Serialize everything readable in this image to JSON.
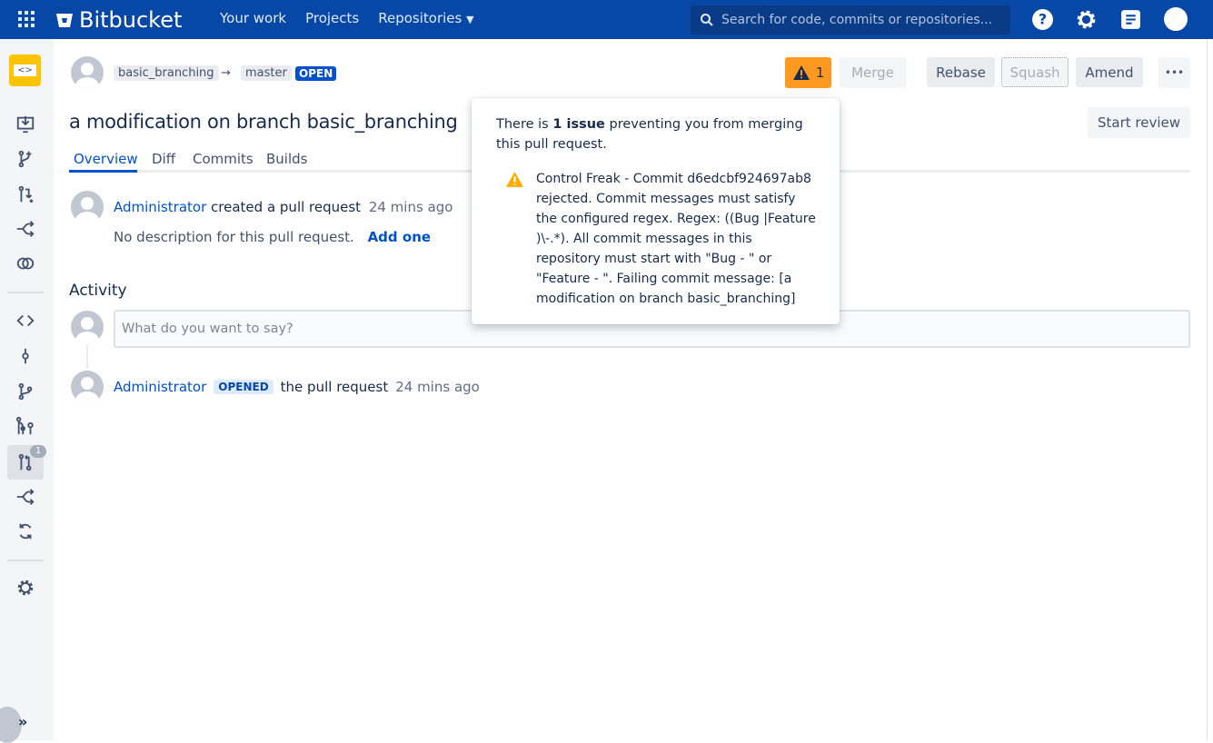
{
  "header": {
    "brand": "Bitbucket",
    "nav": [
      "Your work",
      "Projects",
      "Repositories"
    ],
    "search_placeholder": "Search for code, commits or repositories..."
  },
  "sidebar": {
    "pull_requests_badge": "1",
    "items": [
      "repository",
      "clone",
      "create-branch",
      "create-pull-request",
      "fork",
      "compare",
      "source",
      "commits",
      "branches",
      "all-branches",
      "pull-requests",
      "forks",
      "sync",
      "settings"
    ]
  },
  "pr": {
    "source_branch": "basic_branching",
    "arrow": "→",
    "target_branch": "master",
    "status": "OPEN",
    "title": "a modification on branch basic_branching",
    "tabs": [
      "Overview",
      "Diff",
      "Commits",
      "Builds"
    ],
    "issues_count": "1",
    "buttons": {
      "merge": "Merge",
      "rebase": "Rebase",
      "squash": "Squash",
      "amend": "Amend",
      "more": "•••",
      "start_review": "Start review"
    },
    "created": {
      "author": "Administrator",
      "action": "created a pull request",
      "time": "24 mins ago",
      "no_desc": "No description for this pull request.",
      "add_one": "Add one"
    }
  },
  "activity": {
    "heading": "Activity",
    "comment_placeholder": "What do you want to say?",
    "event": {
      "author": "Administrator",
      "badge": "OPENED",
      "text": "the pull request",
      "time": "24 mins ago"
    }
  },
  "popup": {
    "prefix": "There is ",
    "bold": "1 issue",
    "suffix": " preventing you from merging this pull request.",
    "message": "Control Freak - Commit d6edcbf924697ab8 rejected. Commit messages must satisfy the configured regex. Regex: ((Bug |Feature )\\-.*). All commit messages in this repository must start with \"Bug - \" or \"Feature - \". Failing commit message: [a modification on branch basic_branching]"
  },
  "colors": {
    "topbar": "#0747a6",
    "warning": "#ff991f",
    "link": "#0052cc",
    "open_badge": "#0052cc"
  }
}
